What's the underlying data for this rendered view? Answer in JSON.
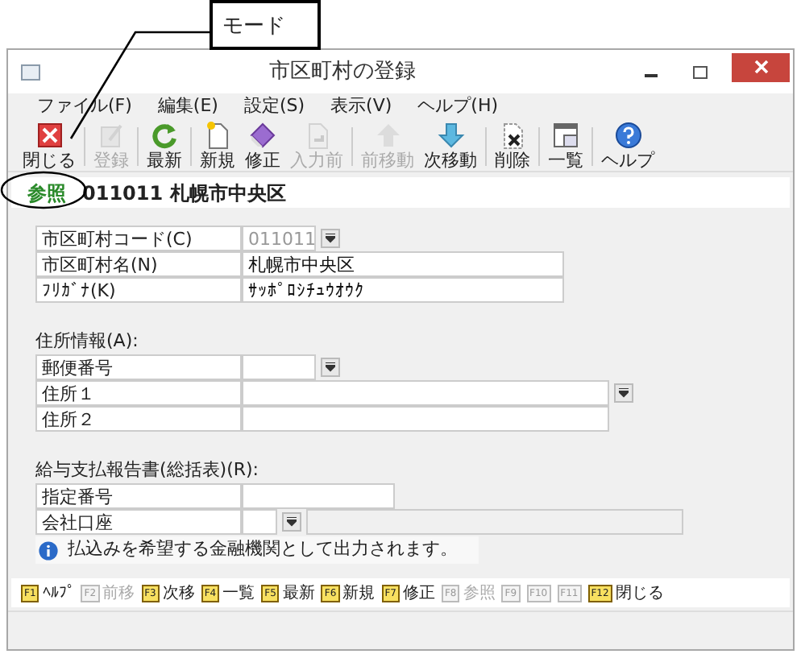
{
  "annotation": {
    "label": "モード"
  },
  "window": {
    "title": "市区町村の登録"
  },
  "menu": [
    "ファイル(F)",
    "編集(E)",
    "設定(S)",
    "表示(V)",
    "ヘルプ(H)"
  ],
  "toolbar": [
    {
      "kind": "close",
      "label": "閉じる",
      "disabled": false
    },
    {
      "kind": "register",
      "label": "登録",
      "disabled": true
    },
    {
      "kind": "refresh",
      "label": "最新",
      "disabled": false
    },
    {
      "kind": "new",
      "label": "新規",
      "disabled": false
    },
    {
      "kind": "edit",
      "label": "修正",
      "disabled": false
    },
    {
      "kind": "revert",
      "label": "入力前",
      "disabled": true
    },
    {
      "kind": "prev",
      "label": "前移動",
      "disabled": true
    },
    {
      "kind": "next",
      "label": "次移動",
      "disabled": false
    },
    {
      "kind": "delete",
      "label": "削除",
      "disabled": false
    },
    {
      "kind": "list",
      "label": "一覧",
      "disabled": false
    },
    {
      "kind": "help",
      "label": "ヘルプ",
      "disabled": false
    }
  ],
  "mode": {
    "label": "参照",
    "record": "011011 札幌市中央区"
  },
  "sections": [
    {
      "fields": [
        {
          "kind": "code",
          "label": "市区町村コード(C)",
          "value": "011011",
          "disabled": true
        },
        {
          "kind": "name",
          "label": "市区町村名(N)",
          "value": "札幌市中央区",
          "disabled": false
        },
        {
          "kind": "name",
          "label": "ﾌﾘｶﾞﾅ(K)",
          "value": "ｻｯﾎﾟﾛｼﾁｭｳｵｳｸ",
          "disabled": false
        }
      ]
    },
    {
      "heading": "住所情報(A):",
      "fields": [
        {
          "kind": "code",
          "label": "郵便番号"
        },
        {
          "kind": "address",
          "label": "住所１"
        },
        {
          "kind": "wide",
          "label": "住所２"
        }
      ]
    },
    {
      "heading": "給与支払報告書(総括表)(R):",
      "fields": [
        {
          "kind": "number",
          "label": "指定番号"
        },
        {
          "kind": "account",
          "label": "会社口座"
        }
      ]
    }
  ],
  "note": "払込みを希望する金融機関として出力されます。",
  "fkeys": [
    {
      "key": "F1",
      "label": "ﾍﾙﾌﾟ",
      "disabled": false
    },
    {
      "key": "F2",
      "label": "前移",
      "disabled": true
    },
    {
      "key": "F3",
      "label": "次移",
      "disabled": false
    },
    {
      "key": "F4",
      "label": "一覧",
      "disabled": false
    },
    {
      "key": "F5",
      "label": "最新",
      "disabled": false
    },
    {
      "key": "F6",
      "label": "新規",
      "disabled": false
    },
    {
      "key": "F7",
      "label": "修正",
      "disabled": false
    },
    {
      "key": "F8",
      "label": "参照",
      "disabled": true
    },
    {
      "key": "F9",
      "disabled": true
    },
    {
      "key": "F10",
      "disabled": true
    },
    {
      "key": "F11",
      "disabled": true
    },
    {
      "key": "F12",
      "label": "閉じる",
      "disabled": false
    }
  ]
}
